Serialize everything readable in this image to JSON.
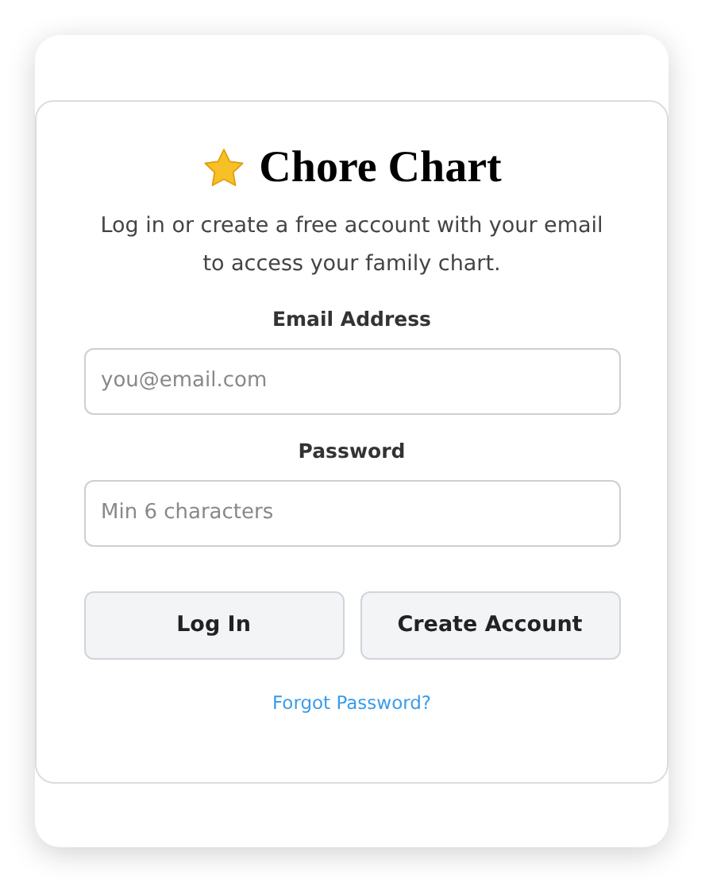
{
  "title": "Chore Chart",
  "subtitle": "Log in or create a free account with your email to access your family chart.",
  "fields": [
    {
      "label": "Email Address",
      "placeholder": "you@email.com"
    },
    {
      "label": "Password",
      "placeholder": "Min 6 characters"
    }
  ],
  "buttons": [
    "Log In",
    "Create Account"
  ],
  "link": "Forgot Password?"
}
